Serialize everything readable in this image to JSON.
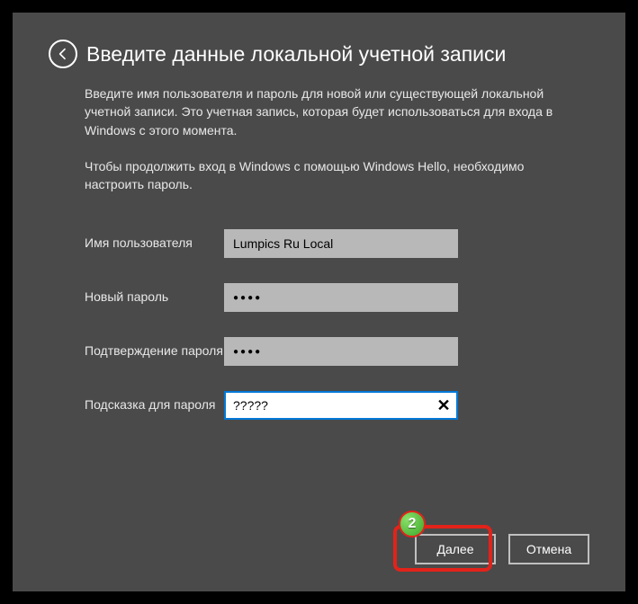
{
  "header": {
    "title": "Введите данные локальной учетной записи"
  },
  "description": "Введите имя пользователя и пароль для новой или существующей локальной учетной записи. Это учетная запись, которая будет использоваться для входа в Windows с этого момента.",
  "note": "Чтобы продолжить вход в Windows с помощью Windows Hello, необходимо настроить пароль.",
  "form": {
    "username_label": "Имя пользователя",
    "username_value": "Lumpics Ru Local",
    "newpass_label": "Новый пароль",
    "newpass_value": "●●●●",
    "confirm_label": "Подтверждение пароля",
    "confirm_value": "●●●●",
    "hint_label": "Подсказка для пароля",
    "hint_value": "?????"
  },
  "buttons": {
    "next": "Далее",
    "cancel": "Отмена"
  },
  "annotations": {
    "badge2": "2"
  }
}
